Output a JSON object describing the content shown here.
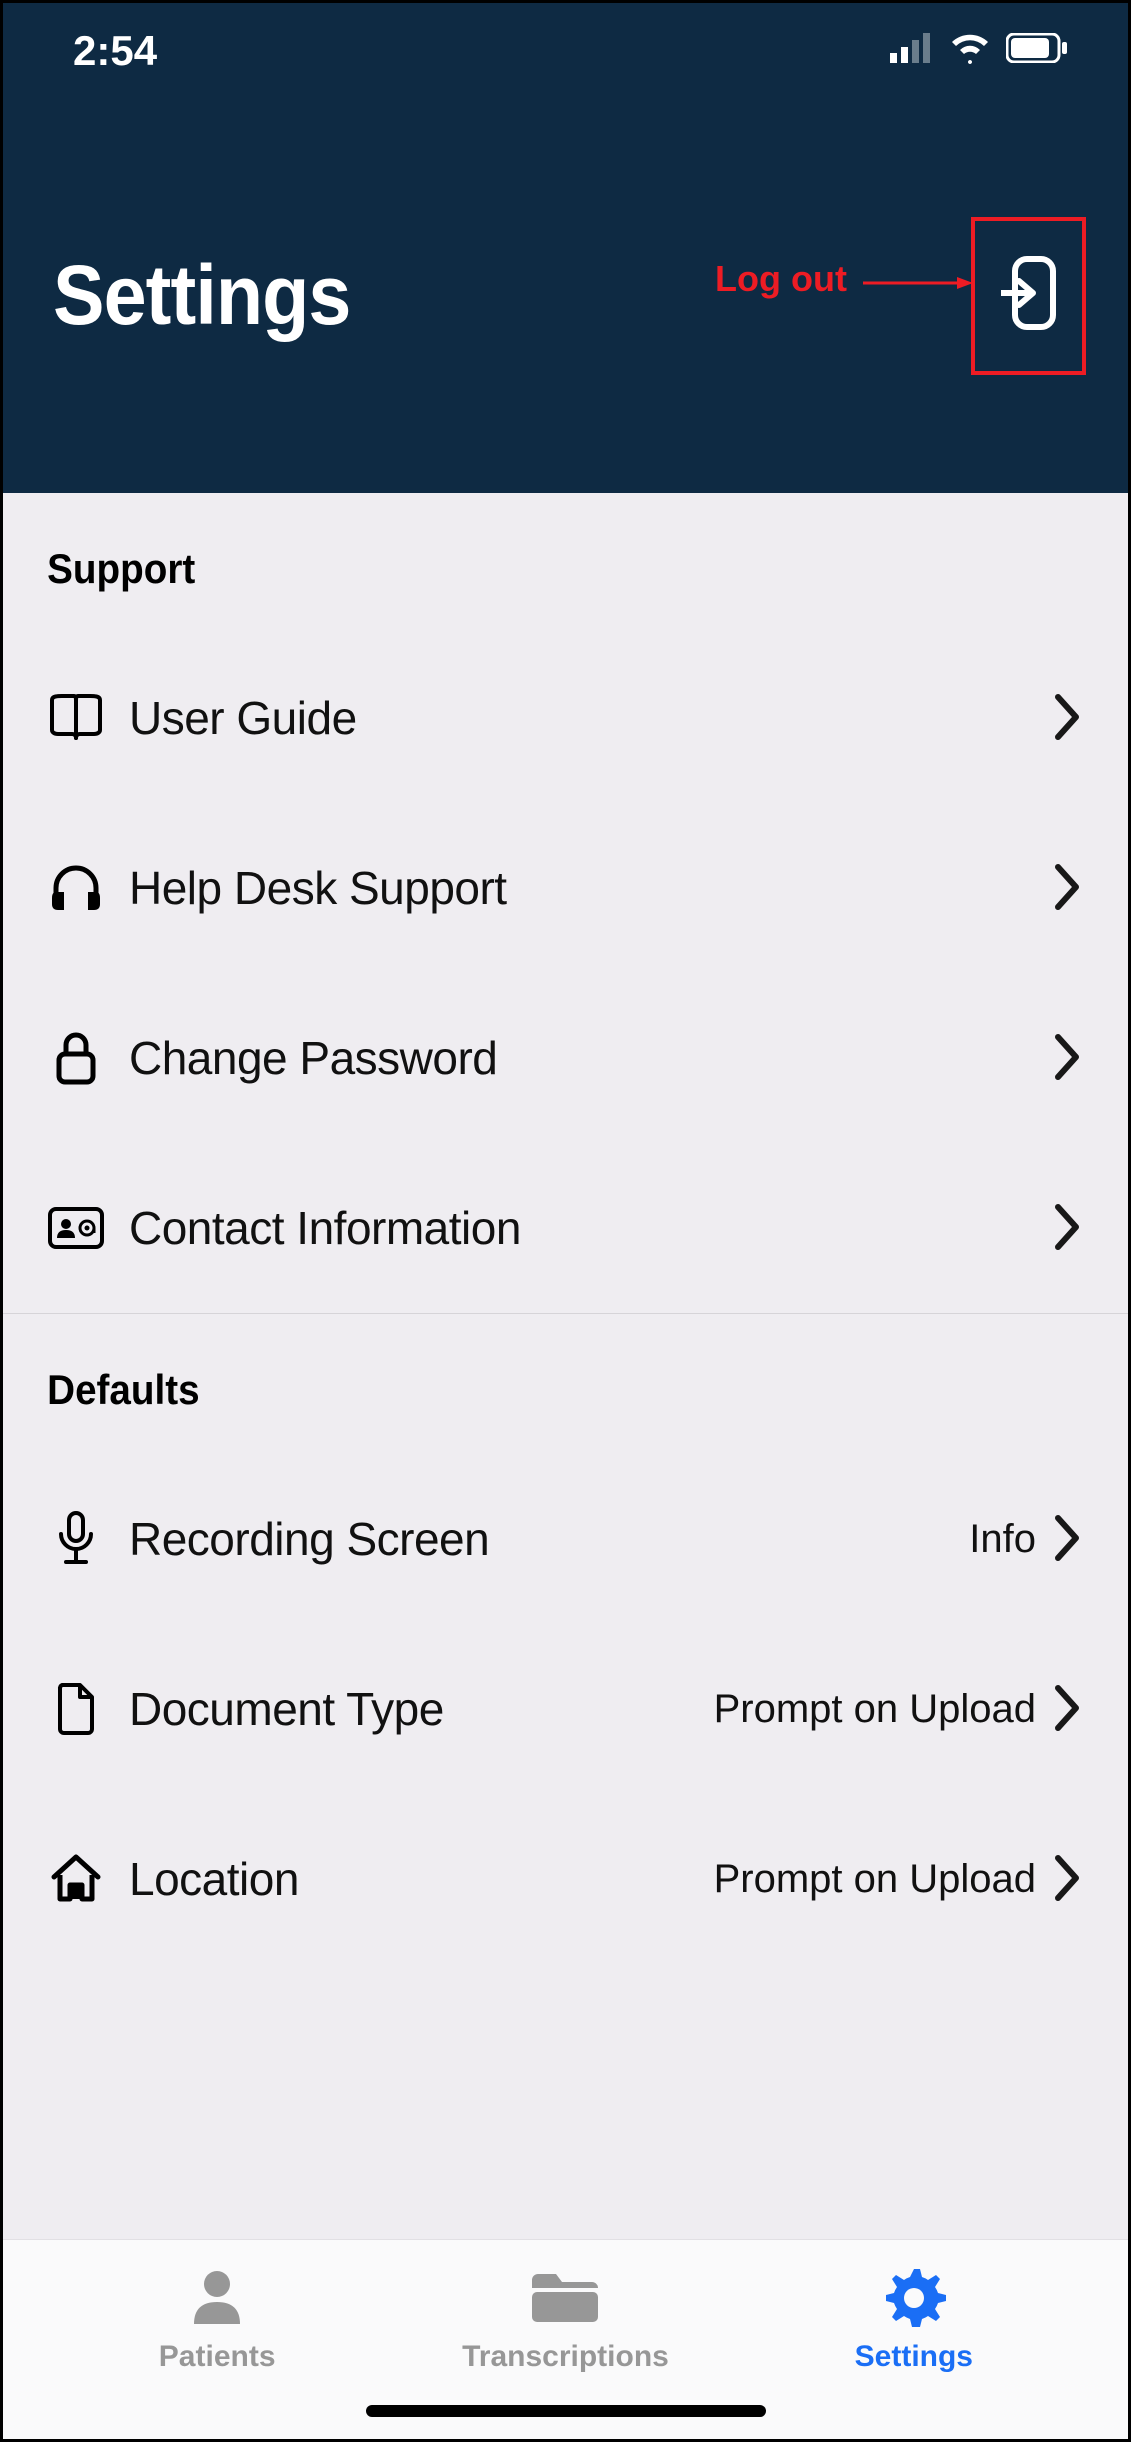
{
  "status": {
    "time": "2:54"
  },
  "header": {
    "title": "Settings",
    "logout_annotation": "Log out"
  },
  "sections": {
    "support": {
      "title": "Support",
      "items": {
        "user_guide": "User Guide",
        "help_desk": "Help Desk Support",
        "change_password": "Change Password",
        "contact_info": "Contact Information"
      }
    },
    "defaults": {
      "title": "Defaults",
      "items": {
        "recording_screen": {
          "label": "Recording Screen",
          "value": "Info"
        },
        "document_type": {
          "label": "Document Type",
          "value": "Prompt on Upload"
        },
        "location": {
          "label": "Location",
          "value": "Prompt on Upload"
        }
      }
    }
  },
  "tabs": {
    "patients": "Patients",
    "transcriptions": "Transcriptions",
    "settings": "Settings"
  }
}
